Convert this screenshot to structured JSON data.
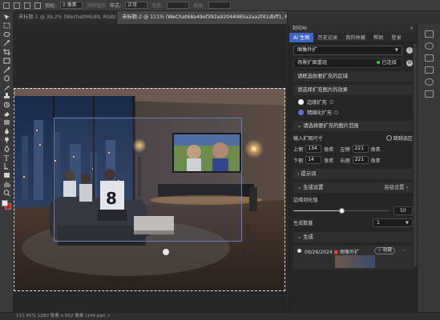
{
  "options_bar": {
    "feather_label": "羽化:",
    "feather_value": "0 像素",
    "anti_alias_label": "消除锯齿",
    "style_label": "样式:",
    "style_value": "正常",
    "width_label": "宽度:",
    "height_label": "高度:"
  },
  "tabs": [
    {
      "label": "未标题-1 @ 39.2% (WechatIMG89, RGB/8*) *",
      "active": false
    },
    {
      "label": "未标题-2 @ 111% (WeChat68a49ef392a92044985a2aa2f41dbff1, RGB/8*) *",
      "active": true
    }
  ],
  "status_bar": {
    "text": "111.45%   1260 像素 x 952 像素 (144 ppi)   >"
  },
  "panel": {
    "title": "封印AI",
    "menu": [
      "AI 生图",
      "历史记录",
      "我的收藏",
      "帮助",
      "登录"
    ],
    "mode_dropdown": "图像外扩",
    "server_label": "场景扩图重组",
    "server_status": "已连接",
    "select_area_label": "请框选你要扩充的区域",
    "effect_section": "请选择扩充图片的效果",
    "effect_options": [
      "边缘扩充",
      "精细化扩充"
    ],
    "range_section": "请选择要扩充的图片范围",
    "input_size_label": "输入扩图尺寸",
    "skip_label": "跳跳选区",
    "top_label": "上侧",
    "top_value": "134",
    "left_label": "左侧",
    "left_value": "221",
    "bottom_label": "下侧",
    "bottom_value": "14",
    "right_label": "右侧",
    "right_value": "221",
    "unit": "像素",
    "prompt_section": "提示词",
    "gen_settings_section": "生成设置",
    "advanced_label": "高级设置",
    "feather_label": "边缘羽化值",
    "feather_value": "50",
    "feather_level": 0.5,
    "count_label": "生成数量",
    "count_value": "1",
    "generate_section": "生成",
    "history_date": "09/26/2024",
    "history_title": "图像外扩",
    "history_button": "收藏"
  },
  "toolbar_tools": [
    "move",
    "marquee",
    "lasso",
    "magic-wand",
    "crop",
    "frame",
    "eyedropper",
    "heal",
    "brush",
    "stamp",
    "history-brush",
    "eraser",
    "gradient",
    "blur",
    "dodge",
    "pen",
    "type",
    "path-select",
    "shape",
    "hand",
    "zoom"
  ]
}
